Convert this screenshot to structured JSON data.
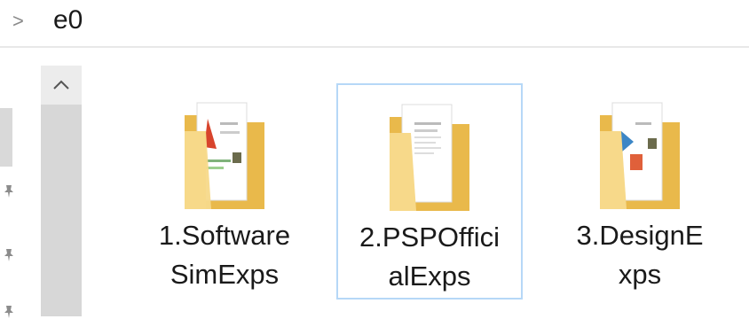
{
  "address_bar": {
    "chevron": ">",
    "path_segment": "e0"
  },
  "icons": {
    "chevron": "chevron-right-icon",
    "scroll_up": "chevron-up-icon",
    "pin": "pin-icon",
    "folder": "folder-icon"
  },
  "colors": {
    "folder_back": "#f0c760",
    "folder_front": "#f7d98a",
    "selection_border": "#b6d8f7"
  },
  "folders": [
    {
      "label_line1": "1.Software",
      "label_line2": "SimExps",
      "selected": false
    },
    {
      "label_line1": "2.PSPOffici",
      "label_line2": "alExps",
      "selected": true
    },
    {
      "label_line1": "3.DesignE",
      "label_line2": "xps",
      "selected": false
    }
  ]
}
